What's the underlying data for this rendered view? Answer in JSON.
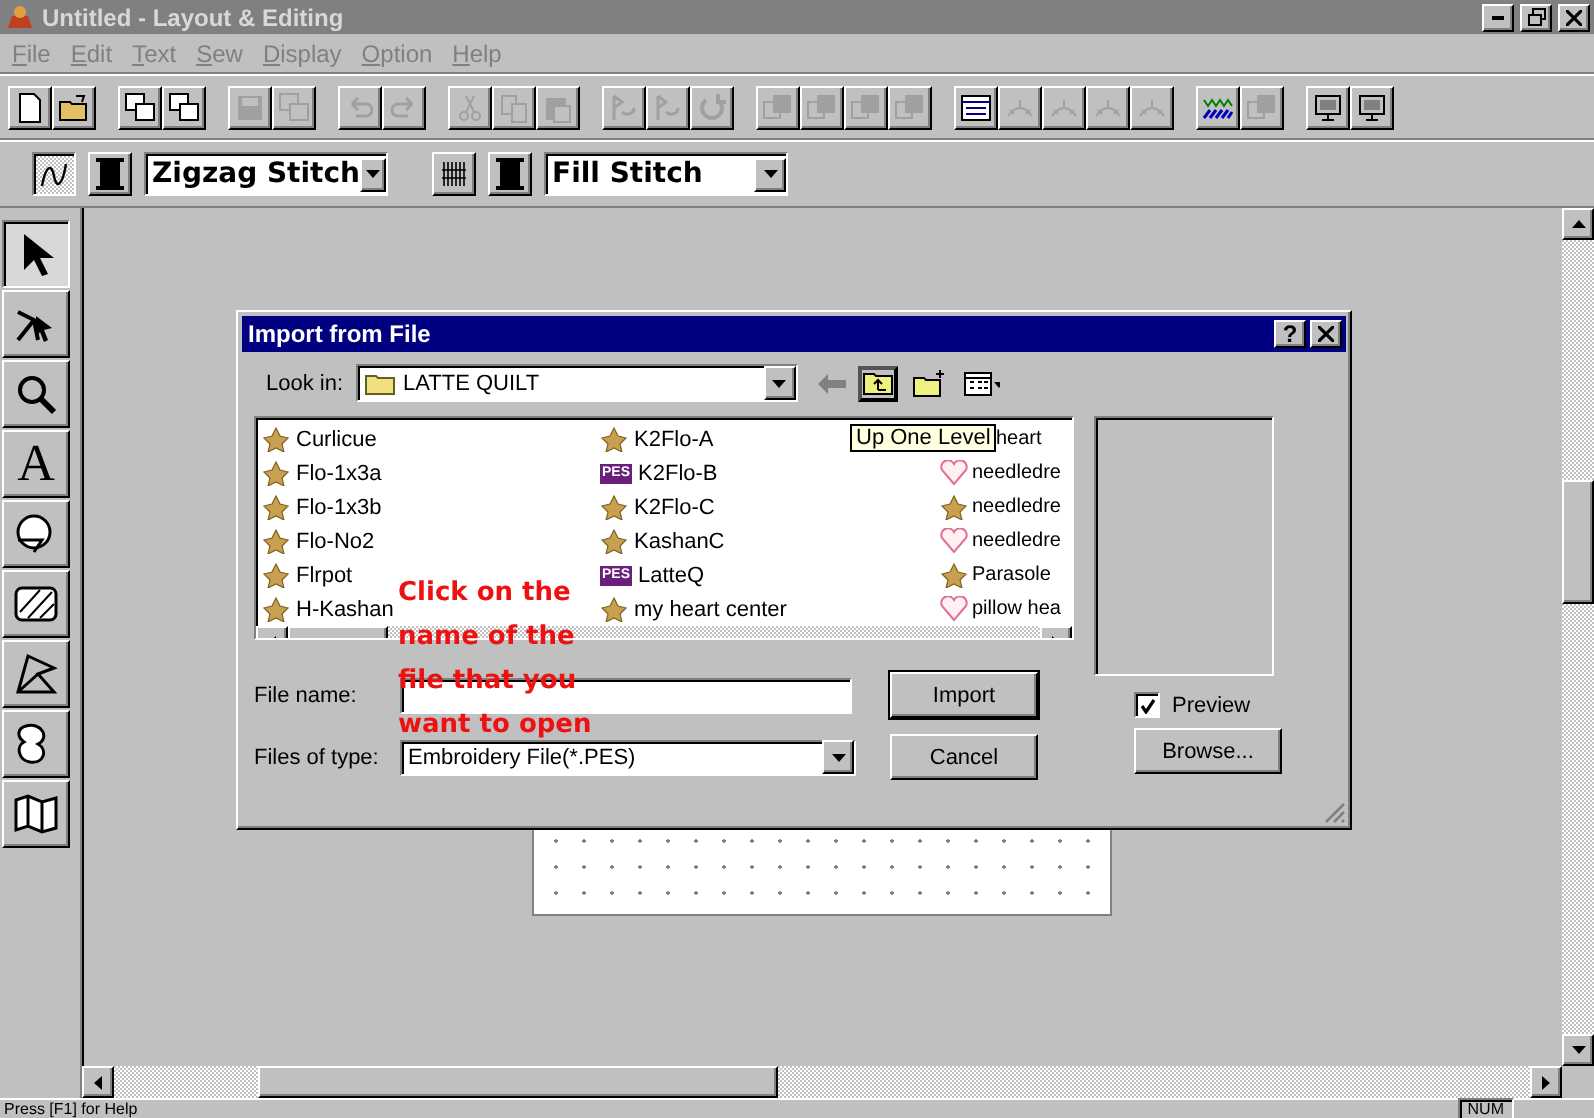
{
  "window": {
    "title": "Untitled - Layout & Editing"
  },
  "menu": [
    {
      "label": "File"
    },
    {
      "label": "Edit"
    },
    {
      "label": "Text"
    },
    {
      "label": "Sew"
    },
    {
      "label": "Display"
    },
    {
      "label": "Option"
    },
    {
      "label": "Help"
    }
  ],
  "toolbar": [
    [
      {
        "kind": "page",
        "disabled": false
      },
      {
        "kind": "folder",
        "disabled": false
      }
    ],
    [
      {
        "kind": "windows",
        "disabled": false
      },
      {
        "kind": "windows",
        "disabled": false
      }
    ],
    [
      {
        "kind": "floppy",
        "disabled": true
      },
      {
        "kind": "windows",
        "disabled": true
      }
    ],
    [
      {
        "kind": "undo",
        "disabled": true
      },
      {
        "kind": "redo",
        "disabled": true
      }
    ],
    [
      {
        "kind": "scissors",
        "disabled": true
      },
      {
        "kind": "copy",
        "disabled": true
      },
      {
        "kind": "paste",
        "disabled": true
      }
    ],
    [
      {
        "kind": "flip",
        "disabled": true
      },
      {
        "kind": "flip",
        "disabled": true
      },
      {
        "kind": "rotate",
        "disabled": true
      }
    ],
    [
      {
        "kind": "layers",
        "disabled": true
      },
      {
        "kind": "layers",
        "disabled": true
      },
      {
        "kind": "layers",
        "disabled": true
      },
      {
        "kind": "layers",
        "disabled": true
      }
    ],
    [
      {
        "kind": "textbox",
        "disabled": false
      },
      {
        "kind": "textarc",
        "disabled": true
      },
      {
        "kind": "textarc",
        "disabled": true
      },
      {
        "kind": "textarc",
        "disabled": true
      },
      {
        "kind": "textarc",
        "disabled": true
      }
    ],
    [
      {
        "kind": "wave",
        "disabled": false
      },
      {
        "kind": "layers",
        "disabled": true
      }
    ],
    [
      {
        "kind": "monitor",
        "disabled": false
      },
      {
        "kind": "monitor",
        "disabled": false
      }
    ]
  ],
  "stitch_bar": [
    {
      "kind": "line",
      "pressed": true
    },
    {
      "kind": "spool"
    },
    {
      "kind": "select",
      "value": "Zigzag Stitch"
    },
    {
      "kind": "fill",
      "pressed": false
    },
    {
      "kind": "spool"
    },
    {
      "kind": "select",
      "value": "Fill Stitch"
    }
  ],
  "tools": [
    {
      "kind": "arrow",
      "selected": true
    },
    {
      "kind": "node",
      "selected": false
    },
    {
      "kind": "zoom",
      "selected": false
    },
    {
      "kind": "text",
      "glyph": "A",
      "selected": false
    },
    {
      "kind": "circle",
      "selected": false
    },
    {
      "kind": "hatch",
      "selected": false
    },
    {
      "kind": "polygon",
      "selected": false
    },
    {
      "kind": "blob",
      "selected": false
    },
    {
      "kind": "map",
      "selected": false
    }
  ],
  "dialog": {
    "title": "Import from File",
    "help": "?",
    "look_in": {
      "label": "Look in:",
      "value": "LATTE QUILT"
    },
    "tooltip": "Up One Level",
    "files": [
      [
        {
          "name": "Curlicue",
          "kind": "design"
        },
        {
          "name": "Flo-1x3a",
          "kind": "design"
        },
        {
          "name": "Flo-1x3b",
          "kind": "design"
        },
        {
          "name": "Flo-No2",
          "kind": "design"
        },
        {
          "name": "Flrpot",
          "kind": "design"
        },
        {
          "name": "H-Kashan",
          "kind": "design"
        }
      ],
      [
        {
          "name": "K2Flo-A",
          "kind": "design"
        },
        {
          "name": "K2Flo-B",
          "kind": "pes",
          "badge": "PES"
        },
        {
          "name": "K2Flo-C",
          "kind": "design"
        },
        {
          "name": "KashanC",
          "kind": "design"
        },
        {
          "name": "LatteQ",
          "kind": "pes",
          "badge": "PES"
        },
        {
          "name": "my heart center",
          "kind": "design"
        }
      ],
      [
        {
          "name": "heart",
          "kind": "hidden"
        },
        {
          "name": "needledre",
          "kind": "heart"
        },
        {
          "name": "needledre",
          "kind": "design"
        },
        {
          "name": "needledre",
          "kind": "heart"
        },
        {
          "name": "Parasole",
          "kind": "design"
        },
        {
          "name": "pillow hea",
          "kind": "heart"
        }
      ]
    ],
    "file_name": {
      "label": "File name:"
    },
    "file_type": {
      "label": "Files of type:",
      "value": "Embroidery File(*.PES)"
    },
    "buttons": [
      "Import",
      "Cancel"
    ],
    "preview": {
      "label": "Preview",
      "checked": true
    },
    "browse": "Browse...",
    "annotation": [
      "Click on the",
      "name of the",
      "file that you",
      "want to open"
    ]
  },
  "status_bar": {
    "text": "Press [F1] for Help",
    "indicator": "NUM"
  }
}
